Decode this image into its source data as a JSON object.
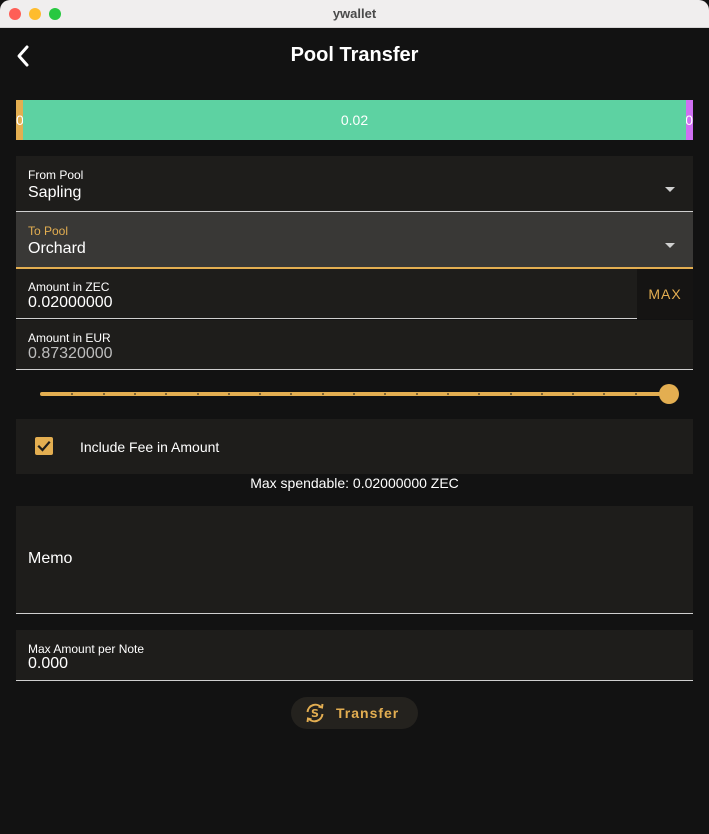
{
  "window": {
    "title": "ywallet"
  },
  "header": {
    "title": "Pool Transfer"
  },
  "pool_balances": {
    "transparent_label": "0",
    "sapling_label": "0.02",
    "orchard_label": "0",
    "colors": {
      "transparent": "#e3ae51",
      "sapling": "#5dd2a2",
      "orchard": "#cf6ff2"
    }
  },
  "from_pool": {
    "label": "From Pool",
    "value": "Sapling"
  },
  "to_pool": {
    "label": "To Pool",
    "value": "Orchard"
  },
  "amount_zec": {
    "label": "Amount in ZEC",
    "value": "0.02000000",
    "max_label": "MAX"
  },
  "amount_eur": {
    "label": "Amount in EUR",
    "value": "0.87320000"
  },
  "slider": {
    "value_fraction": 1.0
  },
  "fee": {
    "label": "Include Fee in Amount",
    "checked": true
  },
  "max_spendable": "Max spendable: 0.02000000 ZEC",
  "memo": {
    "label": "Memo"
  },
  "max_note": {
    "label": "Max Amount per Note",
    "value": "0.000"
  },
  "transfer": {
    "label": "Transfer"
  },
  "colors": {
    "accent": "#e3ae51",
    "background": "#121212",
    "field": "#1e1d1b"
  },
  "icons": {
    "back": "back-arrow-icon",
    "transfer": "transfer-icon",
    "checkbox": "check-icon",
    "dropdown": "chevron-down-icon"
  }
}
